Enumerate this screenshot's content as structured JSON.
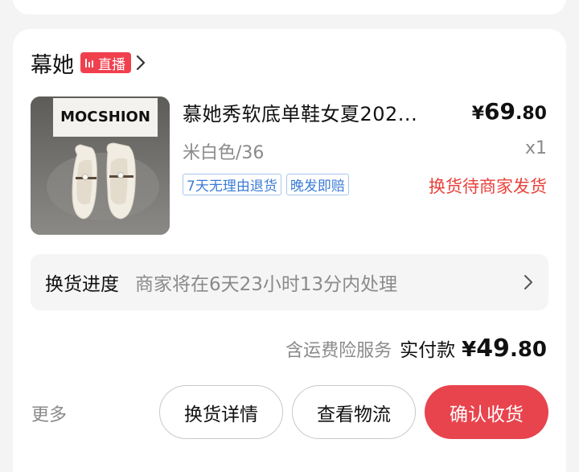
{
  "shop": {
    "name": "幕她",
    "live_label": "直播"
  },
  "product": {
    "title": "慕她秀软底单鞋女夏202...",
    "image_text": "MOCSHION",
    "price_yen": "¥",
    "price_int": "69",
    "price_cents": ".80",
    "variant": "米白色/36",
    "quantity": "x1",
    "tags": [
      "7天无理由退货",
      "晚发即赔"
    ],
    "exchange_status": "换货待商家发货"
  },
  "progress": {
    "label": "换货进度",
    "text": "商家将在6天23小时13分内处理"
  },
  "payment": {
    "note": "含运费险服务",
    "label": "实付款",
    "yen": "¥",
    "int": "49",
    "cents": ".80"
  },
  "actions": {
    "more": "更多",
    "exchange_details": "换货详情",
    "view_logistics": "查看物流",
    "confirm_receipt": "确认收货"
  },
  "colors": {
    "accent_red": "#e8444d",
    "status_red": "#e8413c",
    "tag_blue": "#3b7bd6"
  }
}
